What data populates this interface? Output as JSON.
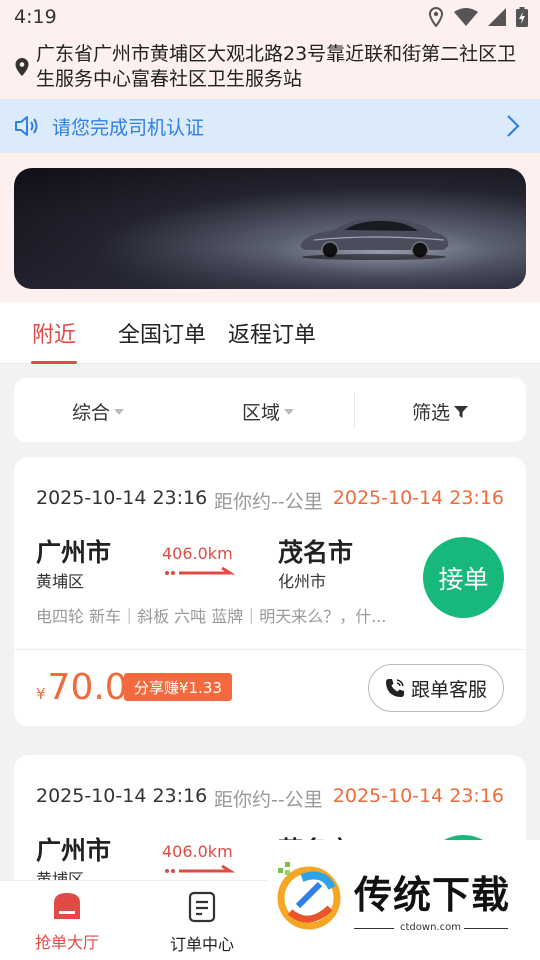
{
  "status": {
    "time": "4:19"
  },
  "location": {
    "address": "广东省广州市黄埔区大观北路23号靠近联和街第二社区卫生服务中心富春社区卫生服务站"
  },
  "notice": {
    "text": "请您完成司机认证"
  },
  "tabs": [
    {
      "label": "附近",
      "active": true
    },
    {
      "label": "全国订单"
    },
    {
      "label": "返程订单"
    }
  ],
  "filters": [
    {
      "label": "综合"
    },
    {
      "label": "区域"
    },
    {
      "label": "筛选"
    }
  ],
  "orders": [
    {
      "time": "2025-10-14 23:16",
      "distance": "距你约--公里",
      "deadline": "2025-10-14 23:16",
      "from_city": "广州市",
      "from_district": "黄埔区",
      "km": "406.0km",
      "to_city": "茂名市",
      "to_district": "化州市",
      "accept": "接单",
      "desc": "电四轮 新车｜斜板 六吨 蓝牌｜明天来么？，什...",
      "currency": "¥",
      "price": "70.0",
      "share": "分享赚¥1.33",
      "service": "跟单客服"
    },
    {
      "time": "2025-10-14 23:16",
      "distance": "距你约--公里",
      "deadline": "2025-10-14 23:16",
      "from_city": "广州市",
      "from_district": "黄埔区",
      "km": "406.0km",
      "to_city": "茂名市"
    }
  ],
  "nav": [
    {
      "label": "抢单大厅",
      "active": true
    },
    {
      "label": "订单中心"
    }
  ],
  "watermark": {
    "title": "传统下载",
    "url": "ctdown.com"
  },
  "colors": {
    "accent": "#e14a45",
    "accept": "#16b97b",
    "price": "#f06a3a",
    "notice": "#2f7fe6"
  }
}
